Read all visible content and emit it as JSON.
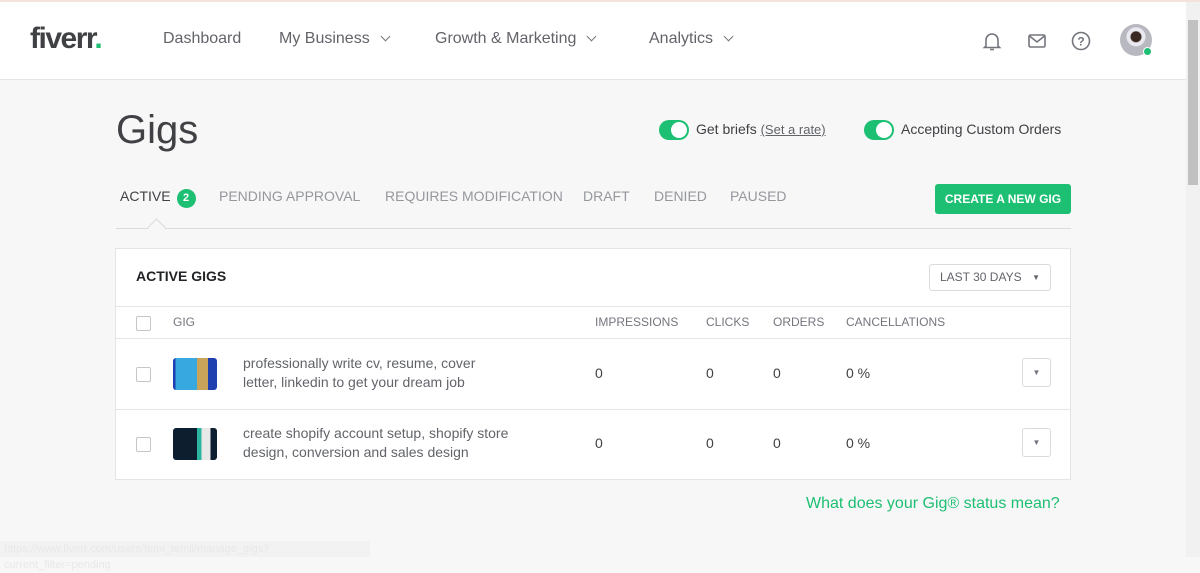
{
  "header": {
    "logo": "fiverr",
    "logo_dot": ".",
    "nav": [
      {
        "label": "Dashboard"
      },
      {
        "label": "My Business"
      },
      {
        "label": "Growth & Marketing"
      },
      {
        "label": "Analytics"
      }
    ]
  },
  "page": {
    "title": "Gigs",
    "get_briefs": "Get briefs",
    "set_rate": "(Set a rate)",
    "custom_orders": "Accepting Custom Orders",
    "get_briefs_on": true,
    "custom_orders_on": true,
    "tabs": [
      {
        "label": "ACTIVE",
        "count": "2"
      },
      {
        "label": "PENDING APPROVAL"
      },
      {
        "label": "REQUIRES MODIFICATION"
      },
      {
        "label": "DRAFT"
      },
      {
        "label": "DENIED"
      },
      {
        "label": "PAUSED"
      }
    ],
    "create_button": "CREATE A NEW GIG"
  },
  "card": {
    "title": "ACTIVE GIGS",
    "range": "LAST 30 DAYS",
    "range_arrow": "▼",
    "columns": [
      "GIG",
      "IMPRESSIONS",
      "CLICKS",
      "ORDERS",
      "CANCELLATIONS"
    ],
    "rows": [
      {
        "title": "professionally write cv, resume, cover letter, linkedin to get your dream job",
        "impressions": "0",
        "clicks": "0",
        "orders": "0",
        "cancellations": "0 %"
      },
      {
        "title": "create shopify account setup, shopify store design, conversion and sales design",
        "impressions": "0",
        "clicks": "0",
        "orders": "0",
        "cancellations": "0 %"
      }
    ]
  },
  "help_link": "What does your Gig® status mean?",
  "status_url": "https://www.fiverr.com/users/temi_temii/manage_gigs?current_filter=pending",
  "colors": {
    "accent": "#1dbf73",
    "text": "#404145"
  }
}
